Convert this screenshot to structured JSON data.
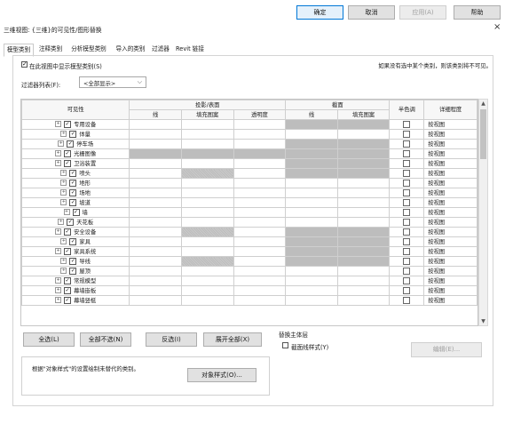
{
  "toolbar": {
    "ok": "确定",
    "cancel": "取消",
    "apply": "应用(A)",
    "help": "帮助"
  },
  "window": {
    "title": "三维视图: {三维}的可见性/图形替换",
    "close": "×"
  },
  "tabs": [
    {
      "label": "模型类别",
      "active": true
    },
    {
      "label": "注释类别",
      "active": false
    },
    {
      "label": "分析模型类别",
      "active": false
    },
    {
      "label": "导入的类别",
      "active": false
    },
    {
      "label": "过滤器",
      "active": false
    },
    {
      "label": "Revit 链接",
      "active": false
    }
  ],
  "options": {
    "show_model_categories_label": "在此视图中显示模型类别(S)",
    "show_model_categories_checked": true,
    "hint": "如果没有选中某个类别，则该类别将不可见。",
    "filter_list_label": "过滤器列表(F):",
    "filter_list_value": "<全部显示>"
  },
  "table": {
    "headers": {
      "visibility": "可见性",
      "projection": "投影/表面",
      "section": "截面",
      "halftone": "半色调",
      "detail_level": "详细程度",
      "line": "线",
      "fill_pattern": "填充图案",
      "transparency": "透明度",
      "section_line": "线",
      "section_fill": "填充图案"
    },
    "rows": [
      {
        "name": "专用设备",
        "proj_fill": "",
        "sec": "gray",
        "detail": "按视图"
      },
      {
        "name": "体量",
        "proj_fill": "",
        "sec": "",
        "detail": "按视图"
      },
      {
        "name": "停车场",
        "proj_fill": "",
        "sec": "gray",
        "detail": "按视图"
      },
      {
        "name": "光栅图像",
        "proj_fill": "",
        "sec": "gray",
        "detail": "按视图",
        "all_gray": true
      },
      {
        "name": "卫浴装置",
        "proj_fill": "",
        "sec": "gray",
        "detail": "按视图"
      },
      {
        "name": "喷头",
        "proj_fill": "hatch",
        "sec": "gray",
        "detail": "按视图"
      },
      {
        "name": "地形",
        "proj_fill": "",
        "sec": "",
        "detail": "按视图"
      },
      {
        "name": "场地",
        "proj_fill": "",
        "sec": "",
        "detail": "按视图"
      },
      {
        "name": "坡道",
        "proj_fill": "",
        "sec": "",
        "detail": "按视图"
      },
      {
        "name": "墙",
        "proj_fill": "",
        "sec": "",
        "detail": "按视图"
      },
      {
        "name": "天花板",
        "proj_fill": "",
        "sec": "",
        "detail": "按视图"
      },
      {
        "name": "安全设备",
        "proj_fill": "hatch",
        "sec": "gray",
        "detail": "按视图"
      },
      {
        "name": "家具",
        "proj_fill": "",
        "sec": "gray",
        "detail": "按视图"
      },
      {
        "name": "家具系统",
        "proj_fill": "",
        "sec": "gray",
        "detail": "按视图"
      },
      {
        "name": "导线",
        "proj_fill": "hatch",
        "sec": "gray",
        "detail": "按视图"
      },
      {
        "name": "屋顶",
        "proj_fill": "",
        "sec": "",
        "detail": "按视图"
      },
      {
        "name": "常规模型",
        "proj_fill": "",
        "sec": "",
        "detail": "按视图"
      },
      {
        "name": "幕墙嵌板",
        "proj_fill": "",
        "sec": "",
        "detail": "按视图"
      },
      {
        "name": "幕墙竖梃",
        "proj_fill": "",
        "sec": "",
        "detail": "按视图"
      }
    ]
  },
  "buttons": {
    "select_all": "全选(L)",
    "select_none": "全部不选(N)",
    "invert": "反选(I)",
    "expand_all": "展开全部(X)",
    "object_styles": "对象样式(O)...",
    "edit": "编辑(E)..."
  },
  "notes": {
    "override_text": "根据\"对象样式\"的设置绘制未替代的类别。"
  },
  "host_layers": {
    "title": "替换主体层",
    "cut_line_styles": "截面线样式(Y)",
    "cut_line_styles_checked": false
  },
  "colors": {
    "gray_cell": "#bdbdbd",
    "primary_border": "#0078d7"
  }
}
